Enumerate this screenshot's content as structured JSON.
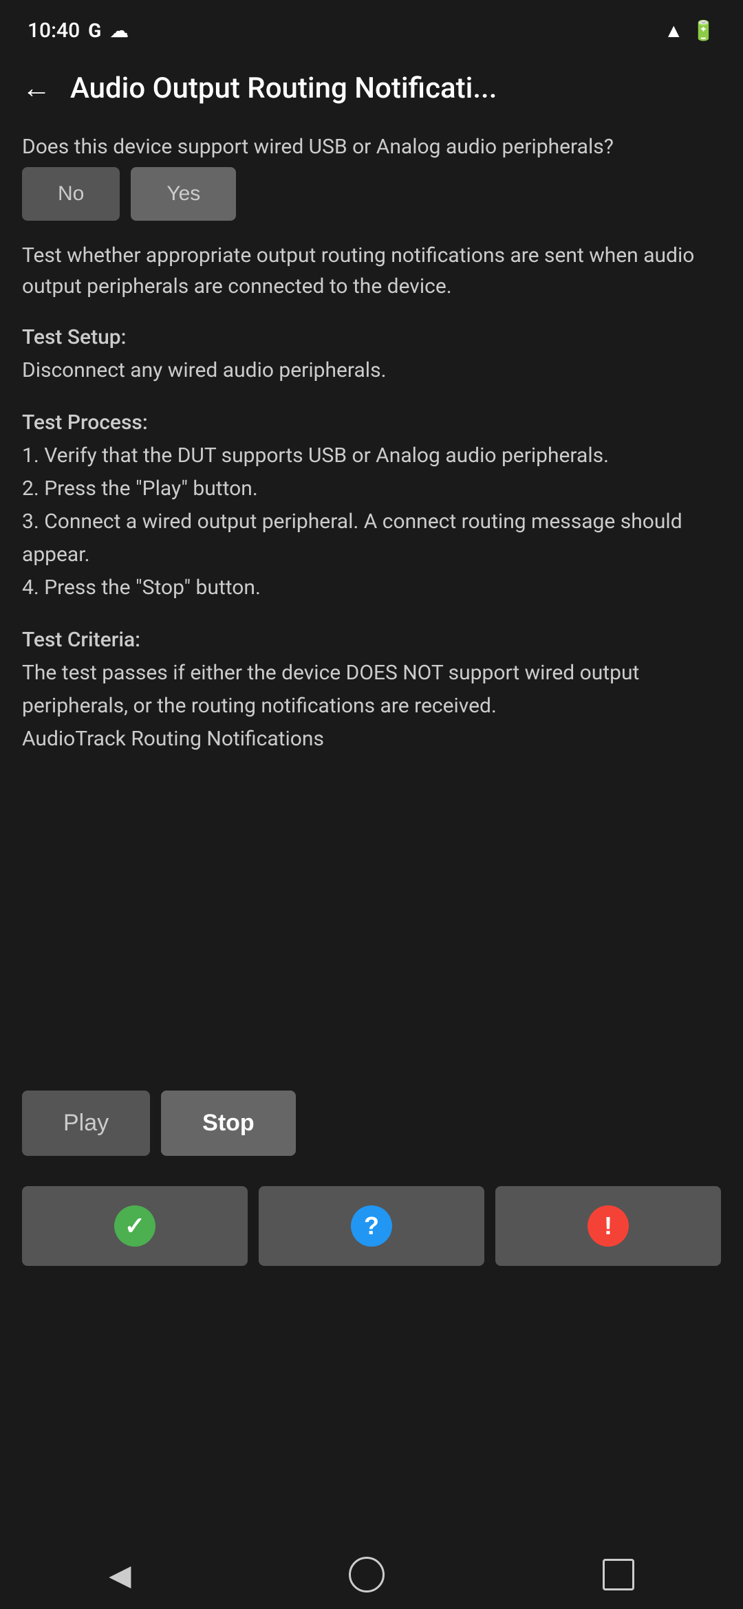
{
  "statusBar": {
    "time": "10:40",
    "icons": [
      "G",
      "cloud",
      "wifi",
      "battery"
    ]
  },
  "header": {
    "backLabel": "←",
    "title": "Audio Output Routing Notificati..."
  },
  "question": {
    "text": "Does this device support wired USB or Analog audio peripherals?",
    "noLabel": "No",
    "yesLabel": "Yes"
  },
  "description": {
    "text": "Test whether appropriate output routing notifications are sent when audio output peripherals are connected to the device."
  },
  "testSetup": {
    "title": "Test Setup:",
    "body": "Disconnect any wired audio peripherals."
  },
  "testProcess": {
    "title": "Test Process:",
    "steps": [
      "1. Verify that the DUT supports USB or Analog audio peripherals.",
      "2. Press the \"Play\" button.",
      "3. Connect a wired output peripheral. A connect routing message should appear.",
      "4. Press the \"Stop\" button."
    ]
  },
  "testCriteria": {
    "title": "Test Criteria:",
    "body": "The test passes if either the device DOES NOT support wired output peripherals, or the routing notifications are received.",
    "footer": "AudioTrack Routing Notifications"
  },
  "actions": {
    "playLabel": "Play",
    "stopLabel": "Stop"
  },
  "results": {
    "passIcon": "✓",
    "infoIcon": "?",
    "failIcon": "!"
  },
  "navBar": {
    "backLabel": "◀"
  }
}
